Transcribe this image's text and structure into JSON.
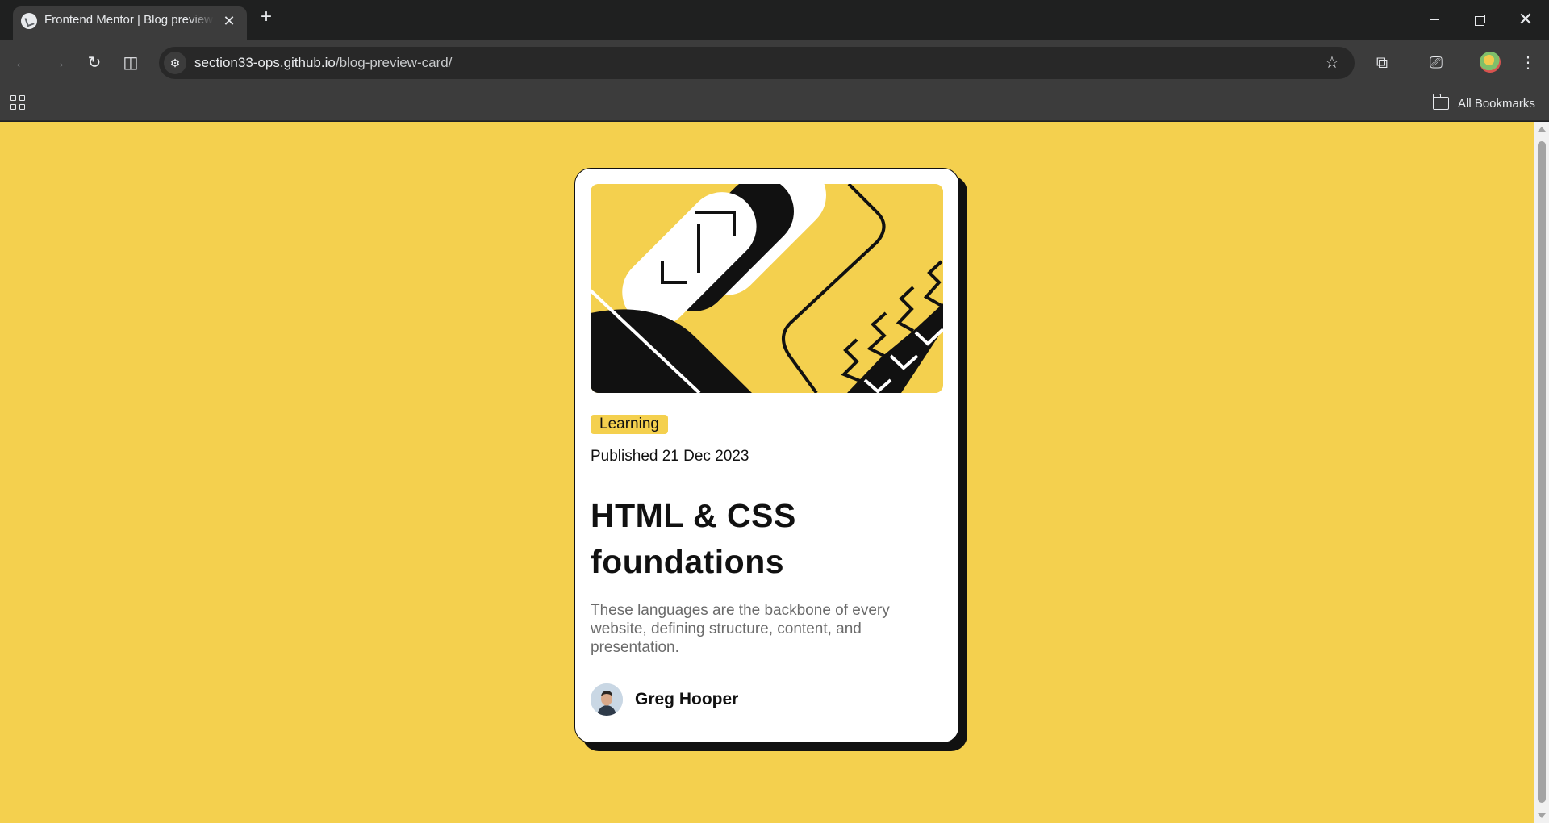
{
  "browser": {
    "tab": {
      "title": "Frontend Mentor | Blog preview card",
      "favicon": "frontend-mentor-favicon",
      "close_symbol": "✕"
    },
    "new_tab_symbol": "+",
    "url": {
      "host": "section33-ops.github.io",
      "path": "/blog-preview-card/"
    },
    "bookmarks": {
      "all_bookmarks_label": "All Bookmarks"
    },
    "icons": [
      "back-arrow-icon",
      "forward-arrow-icon",
      "reload-icon",
      "split-view-icon",
      "site-info-icon",
      "bookmark-star-icon",
      "extensions-icon",
      "cast-search-icon",
      "profile-avatar",
      "more-menu-icon",
      "apps-grid-icon",
      "folder-icon"
    ]
  },
  "page": {
    "background_color": "#f4d04e",
    "card": {
      "tag": "Learning",
      "published": "Published 21 Dec 2023",
      "title": "HTML & CSS foundations",
      "description": "These languages are the backbone of every website, defining structure, content, and presentation.",
      "author": {
        "name": "Greg Hooper",
        "avatar": "author-avatar-photo"
      },
      "colors": {
        "accent": "#f4d04e",
        "ink": "#111111",
        "muted": "#6b6b6b",
        "card": "#ffffff"
      }
    }
  }
}
